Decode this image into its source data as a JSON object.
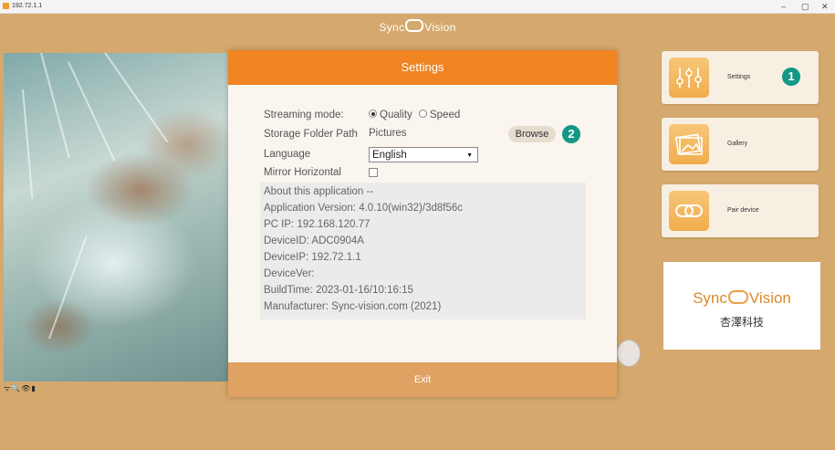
{
  "window": {
    "title": "192.72.1.1",
    "minimize": "–",
    "maximize": "▢",
    "close": "✕"
  },
  "app": {
    "logo_left": "Sync",
    "logo_right": "Vision",
    "status_icons": "ᯤ🔍👁▮"
  },
  "side_panel": {
    "settings_label": "Settings",
    "gallery_label": "Gallery",
    "pair_label": "Pair device",
    "badge_1": "1",
    "badge_2": "2",
    "brand_left": "Sync",
    "brand_right": "Vision",
    "brand_cn": "杏澤科技"
  },
  "settings": {
    "title": "Settings",
    "streaming_label": "Streaming mode:",
    "streaming_options": [
      "Quality",
      "Speed"
    ],
    "streaming_selected": "Quality",
    "storage_label": "Storage Folder Path",
    "storage_value": "Pictures",
    "browse_label": "Browse",
    "language_label": "Language",
    "language_value": "English",
    "mirror_label": "Mirror Horizontal",
    "mirror_checked": false,
    "about": {
      "heading": "About this application --",
      "version": "Application Version: 4.0.10(win32)/3d8f56c",
      "pc_ip": "PC IP: 192.168.120.77",
      "device_id": "DeviceID: ADC0904A",
      "device_ip": "DeviceIP: 192.72.1.1",
      "device_ver": "DeviceVer:",
      "build_time": "BuildTime: 2023-01-16/10:16:15",
      "manufacturer": "Manufacturer: Sync-vision.com (2021)"
    },
    "exit_label": "Exit"
  },
  "colors": {
    "accent": "#ef8421",
    "badge": "#149785",
    "background": "#d5a86d",
    "footer": "#dfa262"
  }
}
